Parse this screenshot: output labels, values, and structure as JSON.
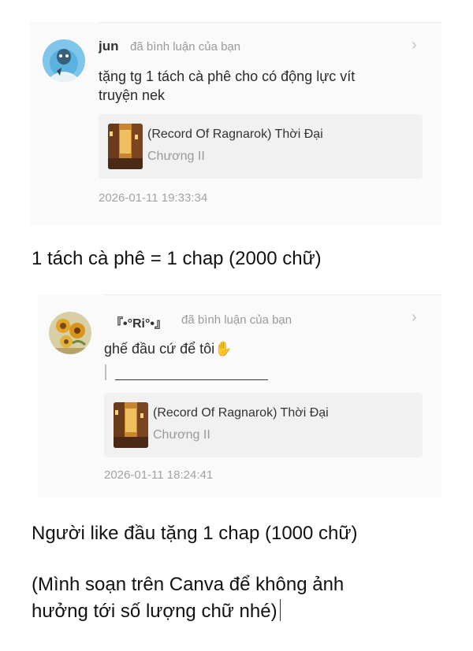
{
  "comments": [
    {
      "username": "jun",
      "action": "đã bình luận của bạn",
      "text_line1": "tặng tg 1 tách cà phê cho có động lực vít",
      "text_line2": "truyện nek",
      "ref_title": "(Record Of Ragnarok) Thời Đại",
      "ref_sub": "Chương II",
      "timestamp": "2026-01-11 19:33:34"
    },
    {
      "username": "『•°Ri°•』",
      "action": "đã bình luận của bạn",
      "text_line1": "ghế đầu cứ để tôi✋",
      "ref_title": "(Record Of Ragnarok) Thời Đại",
      "ref_sub": "Chương II",
      "timestamp": "2026-01-11 18:24:41"
    }
  ],
  "body": {
    "line1": "1 tách cà phê = 1 chap (2000 chữ)",
    "line2": "Người like đầu tặng 1 chap (1000 chữ)",
    "line3a": "(Mình soạn trên Canva để không ảnh",
    "line3b": "hưởng tới số lượng chữ nhé)"
  },
  "icons": {
    "chevron": "chevron-right-icon",
    "avatar1": "blue-character-avatar",
    "avatar2": "sunflower-painting-avatar",
    "thumb": "street-scene-thumbnail"
  }
}
